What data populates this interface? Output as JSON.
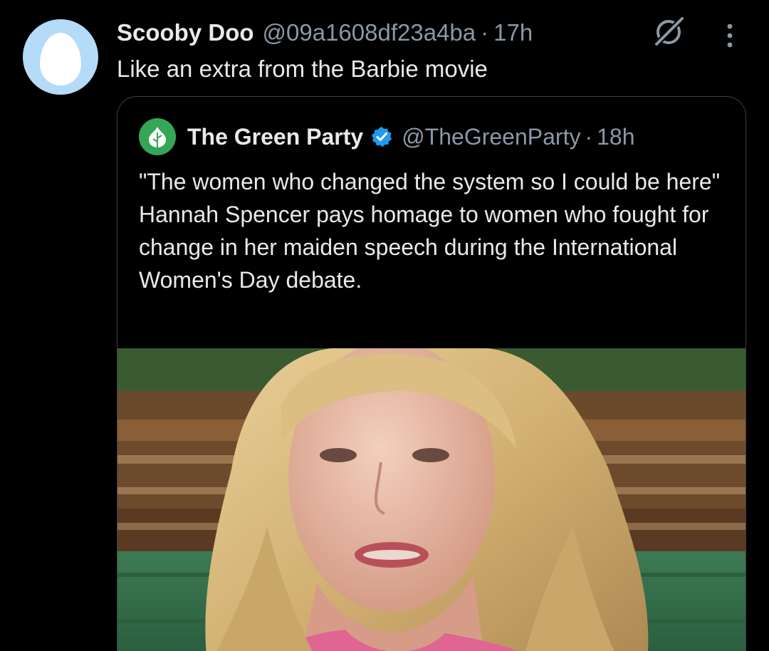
{
  "tweet": {
    "author_name": "Scooby Doo",
    "author_handle": "@09a1608df23a4ba",
    "separator": "·",
    "time": "17h",
    "text": "Like an extra from the Barbie movie"
  },
  "icons": {
    "avatar": "default-egg-avatar",
    "grok": "grok-icon",
    "more": "more-vertical-icon",
    "verified": "verified-badge-icon"
  },
  "quoted_tweet": {
    "author_name": "The Green Party",
    "author_handle": "@TheGreenParty",
    "separator": "·",
    "time": "18h",
    "text_lines": [
      "\"The women who changed the system so I could be here\"",
      "Hannah Spencer pays homage to women who fought for change in her maiden speech during the International Women's Day debate."
    ],
    "media": "video-still-woman-speaking-in-house-of-commons"
  },
  "colors": {
    "background": "#000000",
    "text_primary": "#e7e9ea",
    "text_secondary": "#8b98a5",
    "verified_blue": "#1d9bf0",
    "party_green": "#35a655",
    "avatar_blue": "#b4dbf7",
    "card_border": "#3b4046"
  }
}
